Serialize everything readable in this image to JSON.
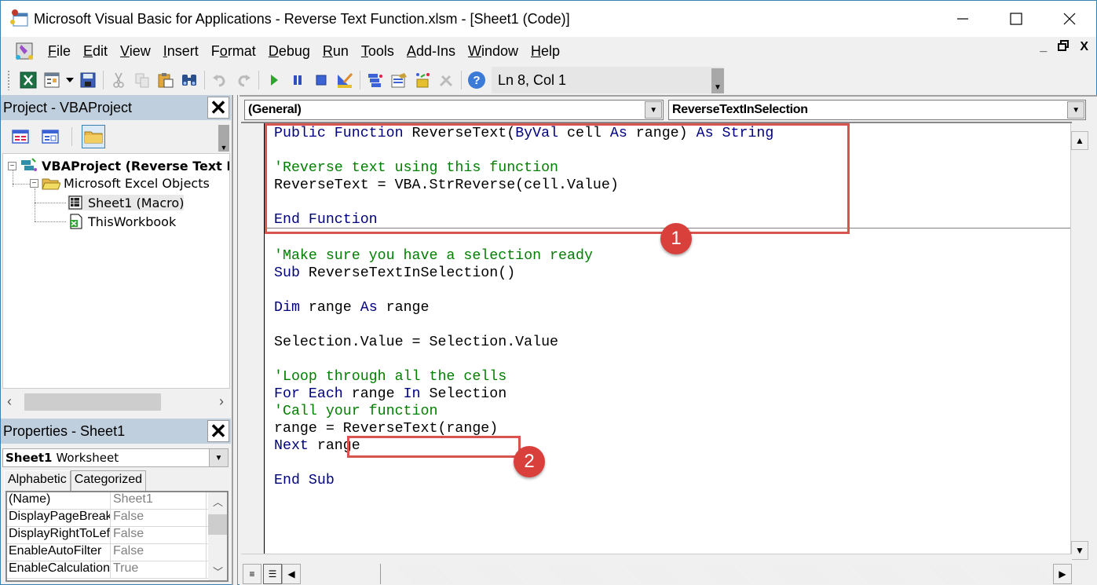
{
  "window": {
    "title": "Microsoft Visual Basic for Applications - Reverse Text Function.xlsm - [Sheet1 (Code)]",
    "controls": {
      "minimize": "—",
      "maximize": "☐",
      "close": "✕"
    }
  },
  "menu": {
    "items": [
      {
        "label": "File",
        "accel": "F"
      },
      {
        "label": "Edit",
        "accel": "E"
      },
      {
        "label": "View",
        "accel": "V"
      },
      {
        "label": "Insert",
        "accel": "I"
      },
      {
        "label": "Format",
        "accel": "o"
      },
      {
        "label": "Debug",
        "accel": "D"
      },
      {
        "label": "Run",
        "accel": "R"
      },
      {
        "label": "Tools",
        "accel": "T"
      },
      {
        "label": "Add-Ins",
        "accel": "A"
      },
      {
        "label": "Window",
        "accel": "W"
      },
      {
        "label": "Help",
        "accel": "H"
      }
    ],
    "mdi_controls": {
      "minimize": "_",
      "restore": "🗗",
      "close": "X"
    }
  },
  "toolbar": {
    "buttons": [
      "view-excel-icon",
      "insert-userform-icon",
      "save-icon",
      "cut-icon",
      "copy-icon",
      "paste-icon",
      "find-icon",
      "undo-icon",
      "redo-icon",
      "run-icon",
      "break-icon",
      "reset-icon",
      "design-mode-icon",
      "project-explorer-icon",
      "properties-window-icon",
      "object-browser-icon",
      "toolbox-icon",
      "help-icon"
    ],
    "position_label": "Ln 8, Col 1"
  },
  "project_pane": {
    "title": "Project - VBAProject",
    "close": "✕",
    "tree": [
      {
        "label": "VBAProject (Reverse Text Fu",
        "bold": true,
        "expander": "−"
      },
      {
        "label": "Microsoft Excel Objects",
        "expander": "−"
      },
      {
        "label": "Sheet1 (Macro)"
      },
      {
        "label": "ThisWorkbook"
      }
    ]
  },
  "properties_pane": {
    "title": "Properties - Sheet1",
    "close": "✕",
    "object_name": "Sheet1",
    "object_type": "Worksheet",
    "tabs": [
      "Alphabetic",
      "Categorized"
    ],
    "active_tab": "Alphabetic",
    "rows": [
      {
        "name": "(Name)",
        "value": "Sheet1"
      },
      {
        "name": "DisplayPageBreaks",
        "value": "False"
      },
      {
        "name": "DisplayRightToLeft",
        "value": "False"
      },
      {
        "name": "EnableAutoFilter",
        "value": "False"
      },
      {
        "name": "EnableCalculation",
        "value": "True"
      }
    ]
  },
  "code_window": {
    "object_combo": "(General)",
    "procedure_combo": "ReverseTextInSelection",
    "function_block": [
      [
        {
          "t": "Public Function ",
          "c": "kw"
        },
        {
          "t": "ReverseText(",
          "c": ""
        },
        {
          "t": "ByVal",
          "c": "kw"
        },
        {
          "t": " cell ",
          "c": ""
        },
        {
          "t": "As",
          "c": "kw"
        },
        {
          "t": " range) ",
          "c": ""
        },
        {
          "t": "As String",
          "c": "kw"
        }
      ],
      [],
      [
        {
          "t": "'Reverse text using this function",
          "c": "cm"
        }
      ],
      [
        {
          "t": "ReverseText = VBA.StrReverse(cell.Value)",
          "c": ""
        }
      ],
      [],
      [
        {
          "t": "End Function",
          "c": "kw"
        }
      ]
    ],
    "sub_block": [
      [],
      [
        {
          "t": "'Make sure you have a selection ready",
          "c": "cm"
        }
      ],
      [
        {
          "t": "Sub",
          "c": "kw"
        },
        {
          "t": " ReverseTextInSelection()",
          "c": ""
        }
      ],
      [],
      [
        {
          "t": "Dim",
          "c": "kw"
        },
        {
          "t": " range ",
          "c": ""
        },
        {
          "t": "As",
          "c": "kw"
        },
        {
          "t": " range",
          "c": ""
        }
      ],
      [],
      [
        {
          "t": "Selection.Value = Selection.Value",
          "c": ""
        }
      ],
      [],
      [
        {
          "t": "'Loop through all the cells",
          "c": "cm"
        }
      ],
      [
        {
          "t": "For Each",
          "c": "kw"
        },
        {
          "t": " range ",
          "c": ""
        },
        {
          "t": "In",
          "c": "kw"
        },
        {
          "t": " Selection",
          "c": ""
        }
      ],
      [
        {
          "t": "'Call your function",
          "c": "cm"
        }
      ],
      [
        {
          "t": "range = ReverseText(range)",
          "c": ""
        }
      ],
      [
        {
          "t": "Next",
          "c": "kw"
        },
        {
          "t": " range",
          "c": ""
        }
      ],
      [],
      [
        {
          "t": "End Sub",
          "c": "kw"
        }
      ]
    ]
  },
  "annotations": [
    {
      "label": "1",
      "target": "function block"
    },
    {
      "label": "2",
      "target": "ReverseText(range) call"
    }
  ],
  "colors": {
    "keyword": "#00007f",
    "comment": "#007f00",
    "annotation": "#d9403c",
    "pane_header": "#bfcfde"
  }
}
